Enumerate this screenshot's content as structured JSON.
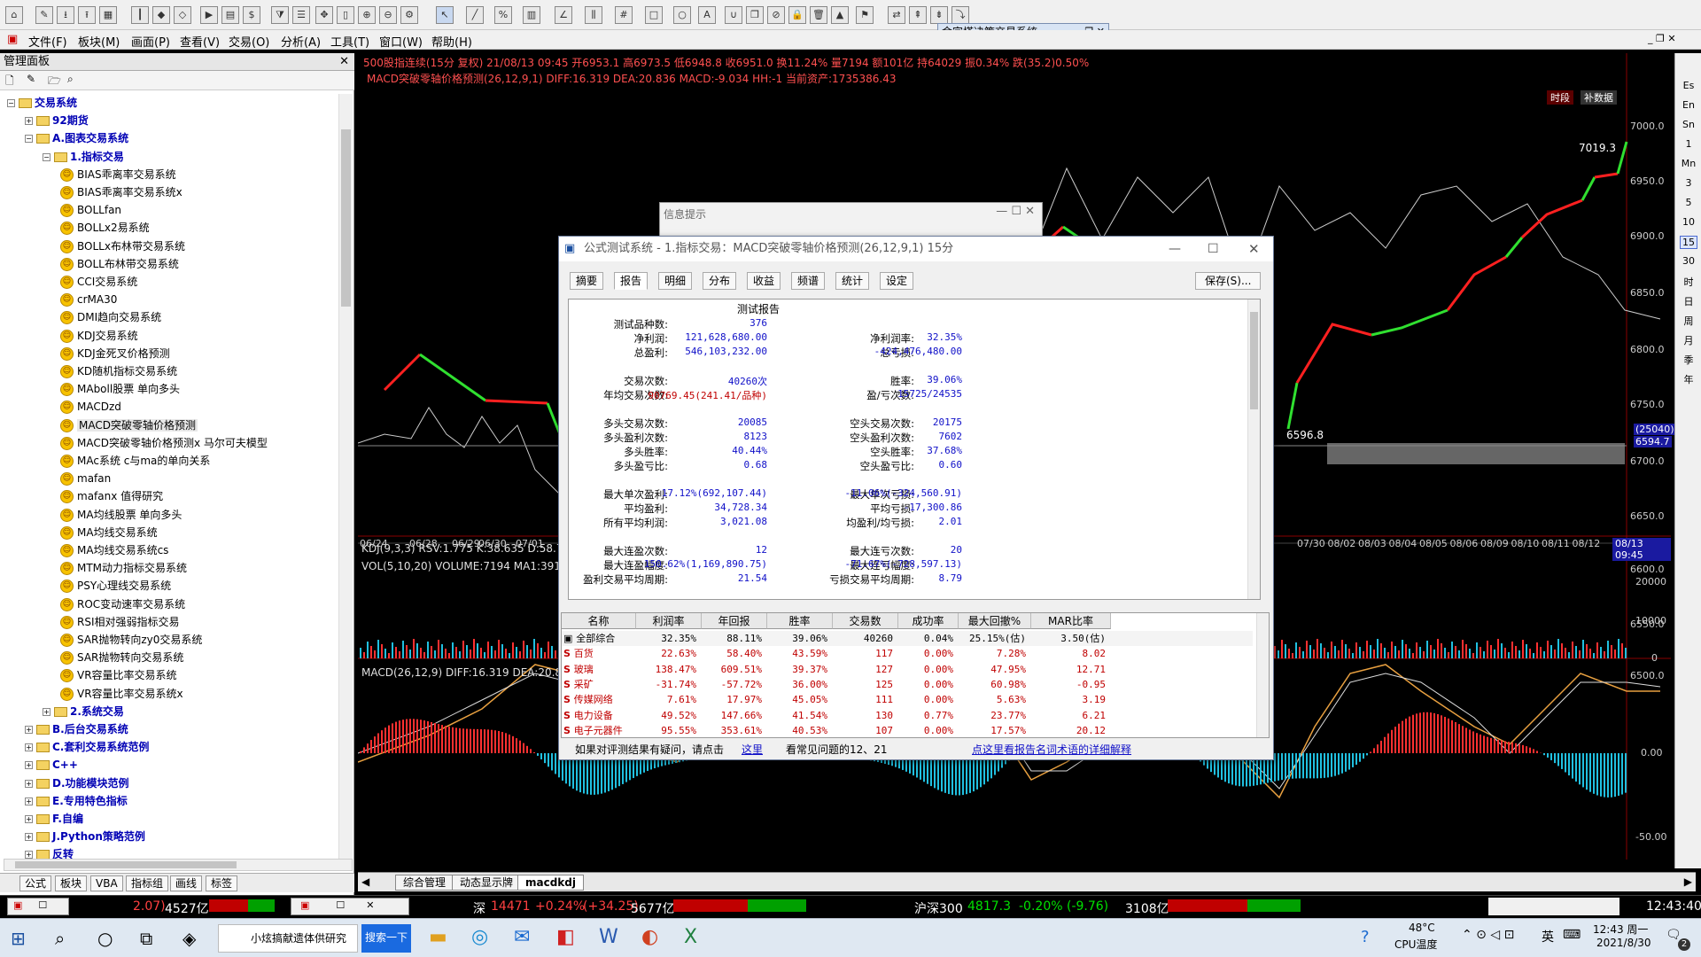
{
  "toolbar": {
    "dollar": "$",
    "letterA": "A"
  },
  "menu": [
    "文件(F)",
    "板块(M)",
    "画面(P)",
    "查看(V)",
    "交易(O)",
    "分析(A)",
    "工具(T)",
    "窗口(W)",
    "帮助(H)"
  ],
  "float_title": "金字塔决策交易系统",
  "panel": {
    "title": "管理面板",
    "tree": [
      {
        "label": "交易系统",
        "level": 0,
        "type": "folder",
        "exp": "−"
      },
      {
        "label": "92期货",
        "level": 1,
        "type": "folder",
        "exp": "+"
      },
      {
        "label": "A.图表交易系统",
        "level": 1,
        "type": "folder",
        "exp": "−"
      },
      {
        "label": "1.指标交易",
        "level": 2,
        "type": "folder",
        "exp": "−"
      },
      {
        "label": "BIAS乖离率交易系统",
        "level": 3,
        "type": "item"
      },
      {
        "label": "BIAS乖离率交易系统x",
        "level": 3,
        "type": "item"
      },
      {
        "label": "BOLLfan",
        "level": 3,
        "type": "item"
      },
      {
        "label": "BOLLx2易系统",
        "level": 3,
        "type": "item"
      },
      {
        "label": "BOLLx布林带交易系统",
        "level": 3,
        "type": "item"
      },
      {
        "label": "BOLL布林带交易系统",
        "level": 3,
        "type": "item"
      },
      {
        "label": "CCI交易系统",
        "level": 3,
        "type": "item"
      },
      {
        "label": "crMA30",
        "level": 3,
        "type": "item"
      },
      {
        "label": "DMI趋向交易系统",
        "level": 3,
        "type": "item"
      },
      {
        "label": "KDJ交易系统",
        "level": 3,
        "type": "item"
      },
      {
        "label": "KDJ金死叉价格预测",
        "level": 3,
        "type": "item"
      },
      {
        "label": "KD随机指标交易系统",
        "level": 3,
        "type": "item"
      },
      {
        "label": "MAboll股票 单向多头",
        "level": 3,
        "type": "item"
      },
      {
        "label": "MACDzd",
        "level": 3,
        "type": "item"
      },
      {
        "label": "MACD突破零轴价格预测",
        "level": 3,
        "type": "item"
      },
      {
        "label": "MACD突破零轴价格预测x 马尔可夫模型",
        "level": 3,
        "type": "item"
      },
      {
        "label": "MAc系统 c与ma的单向关系",
        "level": 3,
        "type": "item"
      },
      {
        "label": "mafan",
        "level": 3,
        "type": "item"
      },
      {
        "label": "mafanx 值得研究",
        "level": 3,
        "type": "item"
      },
      {
        "label": "MA均线股票 单向多头",
        "level": 3,
        "type": "item"
      },
      {
        "label": "MA均线交易系统",
        "level": 3,
        "type": "item"
      },
      {
        "label": "MA均线交易系统cs",
        "level": 3,
        "type": "item"
      },
      {
        "label": "MTM动力指标交易系统",
        "level": 3,
        "type": "item"
      },
      {
        "label": "PSY心理线交易系统",
        "level": 3,
        "type": "item"
      },
      {
        "label": "ROC变动速率交易系统",
        "level": 3,
        "type": "item"
      },
      {
        "label": "RSI相对强弱指标交易",
        "level": 3,
        "type": "item"
      },
      {
        "label": "SAR抛物转向zy0交易系统",
        "level": 3,
        "type": "item"
      },
      {
        "label": "SAR抛物转向交易系统",
        "level": 3,
        "type": "item"
      },
      {
        "label": "VR容量比率交易系统",
        "level": 3,
        "type": "item"
      },
      {
        "label": "VR容量比率交易系统x",
        "level": 3,
        "type": "item"
      },
      {
        "label": "2.系统交易",
        "level": 2,
        "type": "folder",
        "exp": "+"
      },
      {
        "label": "B.后台交易系统",
        "level": 1,
        "type": "folder",
        "exp": "+"
      },
      {
        "label": "C.套利交易系统范例",
        "level": 1,
        "type": "folder",
        "exp": "+"
      },
      {
        "label": "C++",
        "level": 1,
        "type": "folder",
        "exp": "+"
      },
      {
        "label": "D.功能模块范例",
        "level": 1,
        "type": "folder",
        "exp": "+"
      },
      {
        "label": "E.专用特色指标",
        "level": 1,
        "type": "folder",
        "exp": "+"
      },
      {
        "label": "F.自编",
        "level": 1,
        "type": "folder",
        "exp": "+"
      },
      {
        "label": "J.Python策略范例",
        "level": 1,
        "type": "folder",
        "exp": "+"
      },
      {
        "label": "反转",
        "level": 1,
        "type": "folder",
        "exp": "+"
      }
    ],
    "tabs": [
      "公式",
      "板块",
      "VBA",
      "指标组",
      "画线",
      "标签"
    ]
  },
  "chart": {
    "info1": "500股指连续(15分 复权) 21/08/13 09:45 开6953.1 高6973.5 低6948.8 收6951.0 换11.24% 量7194 额101亿 持64029 振0.34% 跌(35.2)0.50%",
    "info2": "MACD突破零轴价格预测(26,12,9,1) DIFF:16.319 DEA:20.836 MACD:-9.034 HH:-1 当前资产:1735386.43",
    "kdj": "KDJ(9,3,3) RSV:1.775 K:38.635 D:58.7",
    "vol": "VOL(5,10,20) VOLUME:7194 MA1:3913",
    "macd": "MACD(26,12,9) DIFF:16.319 DEA:20.83",
    "price_labels": [
      "7000.0",
      "6950.0",
      "6900.0",
      "6850.0",
      "6800.0",
      "6750.0",
      "6700.0",
      "6650.0",
      "6600.0",
      "6550.0",
      "6500.0"
    ],
    "vol_labels": [
      "20000",
      "10000",
      "0"
    ],
    "macd_labels": [
      "0.00",
      "-50.00"
    ],
    "dates_left": [
      "06/24",
      "06/28",
      "06/29",
      "06/30",
      "07/01"
    ],
    "dates_right": [
      "07/30",
      "08/02",
      "08/03",
      "08/04",
      "08/05",
      "08/06",
      "08/09",
      "08/10",
      "08/11",
      "08/12"
    ],
    "date_tag": "08/13 09:45",
    "price_tag": "(25040)",
    "price_tag2": "6594.7",
    "high_label": "7019.3",
    "low_label": "6596.8",
    "tag_a": "时段",
    "tag_b": "补数据"
  },
  "dlg_back_title": "信息提示",
  "dialog": {
    "title": "公式测试系统 - 1.指标交易：MACD突破零轴价格预测(26,12,9,1) 15分",
    "tabs": [
      "摘要",
      "报告",
      "明细",
      "分布",
      "收益",
      "频谱",
      "统计",
      "设定"
    ],
    "save": "保存(S)...",
    "report_title": "测试报告",
    "rows": [
      {
        "l1": "测试品种数:",
        "v1": "376",
        "l2": "",
        "v2": ""
      },
      {
        "l1": "净利润:",
        "v1": "121,628,680.00",
        "l2": "净利润率:",
        "v2": "32.35%"
      },
      {
        "l1": "总盈利:",
        "v1": "546,103,232.00",
        "l2": "总亏损:",
        "v2": "-424,476,480.00"
      },
      {
        "l1": "",
        "v1": "",
        "l2": "",
        "v2": ""
      },
      {
        "l1": "交易次数:",
        "v1": "40260次",
        "l2": "胜率:",
        "v2": "39.06%"
      },
      {
        "l1": "年均交易次数:",
        "v1": "90769.45(241.41/品种)",
        "l2": "盈/亏次数:",
        "v2": "15725/24535"
      },
      {
        "l1": "",
        "v1": "",
        "l2": "",
        "v2": ""
      },
      {
        "l1": "多头交易次数:",
        "v1": "20085",
        "l2": "空头交易次数:",
        "v2": "20175"
      },
      {
        "l1": "多头盈利次数:",
        "v1": "8123",
        "l2": "空头盈利次数:",
        "v2": "7602"
      },
      {
        "l1": "多头胜率:",
        "v1": "40.44%",
        "l2": "空头胜率:",
        "v2": "37.68%"
      },
      {
        "l1": "多头盈亏比:",
        "v1": "0.68",
        "l2": "空头盈亏比:",
        "v2": "0.60"
      },
      {
        "l1": "",
        "v1": "",
        "l2": "",
        "v2": ""
      },
      {
        "l1": "最大单次盈利:",
        "v1": "17.12%(692,107.44)",
        "l2": "最大单次亏损:",
        "v2": "-11.06%(-324,560.91)"
      },
      {
        "l1": "平均盈利:",
        "v1": "34,728.34",
        "l2": "平均亏损:",
        "v2": "-17,300.86"
      },
      {
        "l1": "所有平均利润:",
        "v1": "3,021.08",
        "l2": "均盈利/均亏损:",
        "v2": "2.01"
      },
      {
        "l1": "",
        "v1": "",
        "l2": "",
        "v2": ""
      },
      {
        "l1": "最大连盈次数:",
        "v1": "12",
        "l2": "最大连亏次数:",
        "v2": "20"
      },
      {
        "l1": "最大连盈幅度:",
        "v1": "150.62%(1,169,890.75)",
        "l2": "最大连亏幅度:",
        "v2": "-71.67%(-728,597.13)"
      },
      {
        "l1": "盈利交易平均周期:",
        "v1": "21.54",
        "l2": "亏损交易平均周期:",
        "v2": "8.79"
      }
    ],
    "columns": [
      "名称",
      "利润率",
      "年回报",
      "胜率",
      "交易数",
      "成功率",
      "最大回撤%",
      "MAR比率"
    ],
    "table": [
      {
        "name": "全部综合",
        "vals": [
          "32.35%",
          "88.11%",
          "39.06%",
          "40260",
          "0.04%",
          "25.15%(估)",
          "3.50(估)"
        ],
        "total": true
      },
      {
        "name": "百货",
        "vals": [
          "22.63%",
          "58.40%",
          "43.59%",
          "117",
          "0.00%",
          "7.28%",
          "8.02"
        ]
      },
      {
        "name": "玻璃",
        "vals": [
          "138.47%",
          "609.51%",
          "39.37%",
          "127",
          "0.00%",
          "47.95%",
          "12.71"
        ]
      },
      {
        "name": "采矿",
        "vals": [
          "-31.74%",
          "-57.72%",
          "36.00%",
          "125",
          "0.00%",
          "60.98%",
          "-0.95"
        ]
      },
      {
        "name": "传媒网络",
        "vals": [
          "7.61%",
          "17.97%",
          "45.05%",
          "111",
          "0.00%",
          "5.63%",
          "3.19"
        ]
      },
      {
        "name": "电力设备",
        "vals": [
          "49.52%",
          "147.66%",
          "41.54%",
          "130",
          "0.77%",
          "23.77%",
          "6.21"
        ]
      },
      {
        "name": "电子元器件",
        "vals": [
          "95.55%",
          "353.61%",
          "40.53%",
          "107",
          "0.00%",
          "17.57%",
          "20.12"
        ]
      }
    ],
    "foot1": "如果对评测结果有疑问，请点击",
    "foot_link": "这里",
    "foot2": "看常见问题的12、21",
    "foot3": "点这里看报告名词术语的详细解释"
  },
  "sheets": [
    "综合管理",
    "动态显示牌",
    "macdkdj"
  ],
  "ticker": {
    "t1": "2.07)",
    "t2": "4527亿",
    "sz_name": "深",
    "sz_val": "14471",
    "sz_chg": "+0.24%",
    "sz_pts": "(+34.25)",
    "sz_amt": "5677亿",
    "hs_name": "沪深300",
    "hs_val": "4817.3",
    "hs_chg": "-0.20%",
    "hs_pts": "(-9.76)",
    "hs_amt": "3108亿",
    "time": "12:43:40"
  },
  "taskbar": {
    "app1": "小炫搞献遗体供研究",
    "search": "搜索一下",
    "temp": "48°C",
    "cpu": "CPU温度",
    "ime": "英",
    "time": "12:43 周一",
    "date": "2021/8/30",
    "notif": "2"
  },
  "rightbar": [
    "Es",
    "En",
    "Sn",
    "1",
    "Mn",
    "3",
    "5",
    "10",
    "15",
    "30",
    "时",
    "日",
    "周",
    "月",
    "季",
    "年"
  ]
}
